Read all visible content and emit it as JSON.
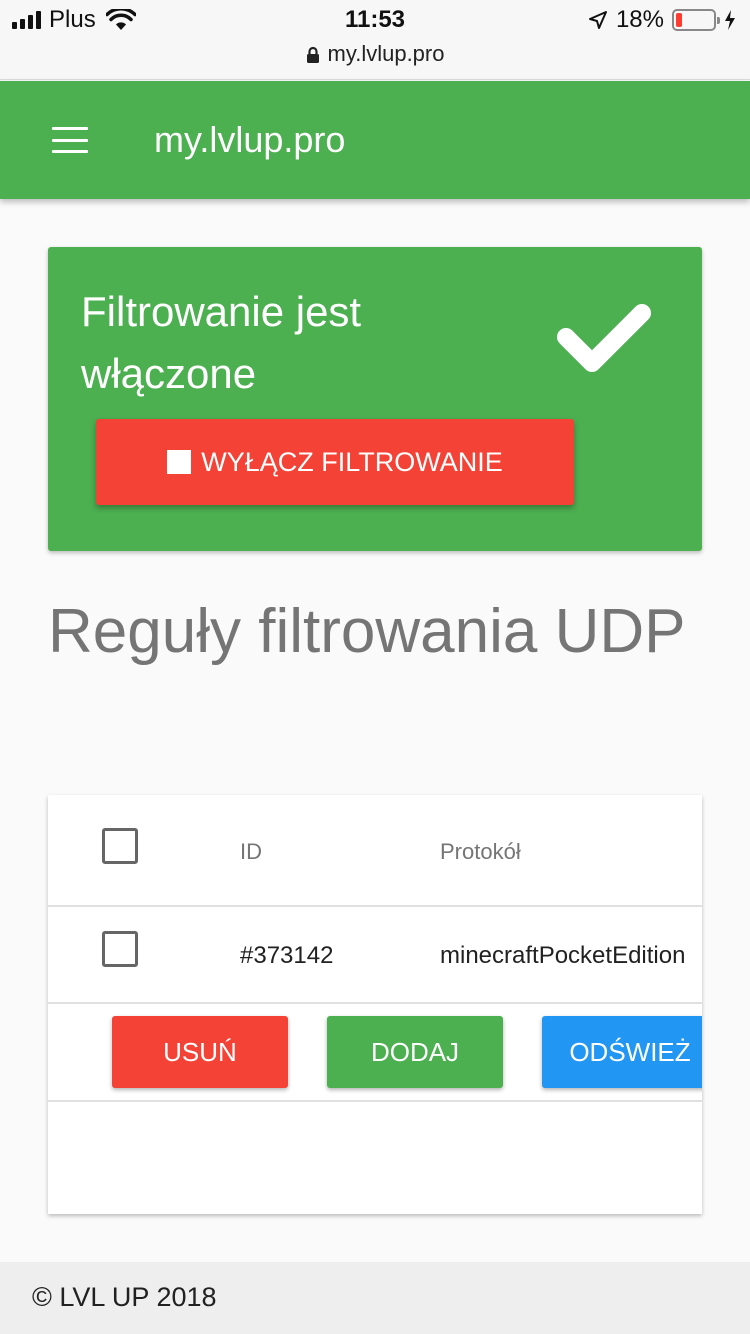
{
  "status_bar": {
    "carrier": "Plus",
    "time": "11:53",
    "url": "my.lvlup.pro",
    "battery_percent": "18%",
    "battery_level": 0.18,
    "icons": [
      "signal-icon",
      "wifi-icon",
      "lock-icon",
      "location-arrow-icon",
      "battery-icon",
      "charging-bolt-icon"
    ]
  },
  "app_bar": {
    "title": "my.lvlup.pro",
    "menu_icon": "hamburger-menu-icon",
    "color": "#4caf50"
  },
  "filter_card": {
    "title": "Filtrowanie jest włączone",
    "status_icon": "checkmark-icon",
    "button_label": "WYŁĄCZ FILTROWANIE",
    "button_icon": "stop-square-icon",
    "card_color": "#4caf50",
    "button_color": "#f44336"
  },
  "rules_section": {
    "heading": "Reguły filtrowania UDP",
    "table": {
      "columns": [
        "ID",
        "Protokół"
      ],
      "rows": [
        {
          "id": "#373142",
          "protocol": "minecraftPocketEdition",
          "checked": false
        }
      ]
    },
    "actions": {
      "delete_label": "USUŃ",
      "add_label": "DODAJ",
      "refresh_label": "ODŚWIEŻ",
      "delete_color": "#f44336",
      "add_color": "#4caf50",
      "refresh_color": "#2196f3"
    }
  },
  "footer": {
    "text": "© LVL UP 2018"
  }
}
